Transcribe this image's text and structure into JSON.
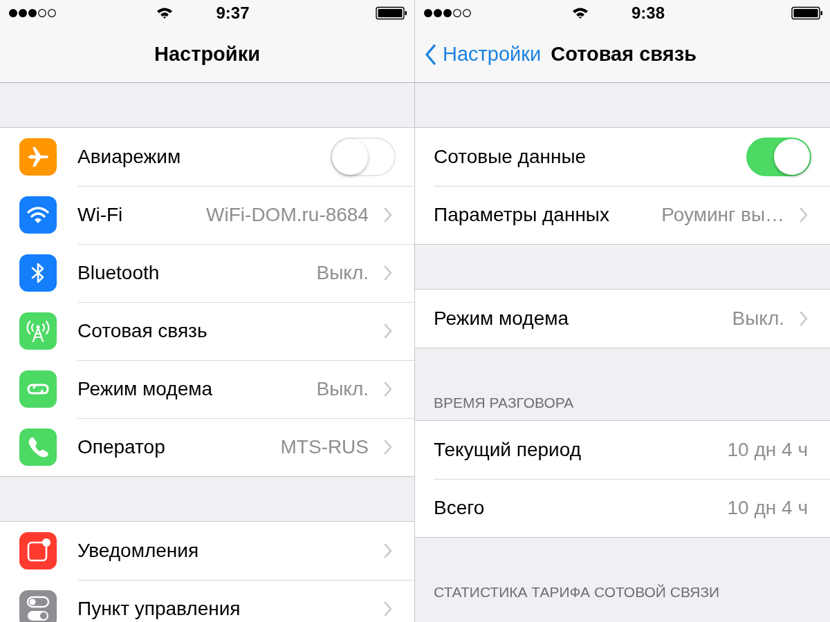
{
  "screens": [
    {
      "status_bar": {
        "time": "9:37"
      },
      "nav": {
        "title": "Настройки"
      },
      "sections": [
        {
          "rows": [
            {
              "kind": "switch",
              "label": "Авиарежим",
              "on": false,
              "color": "#ff9500"
            },
            {
              "kind": "link",
              "label": "Wi-Fi",
              "value": "WiFi-DOM.ru-8684",
              "color": "#147efb"
            },
            {
              "kind": "link",
              "label": "Bluetooth",
              "value": "Выкл.",
              "color": "#147efb"
            },
            {
              "kind": "link",
              "label": "Сотовая связь",
              "color": "#4cd964"
            },
            {
              "kind": "link",
              "label": "Режим модема",
              "value": "Выкл.",
              "color": "#4cd964"
            },
            {
              "kind": "link",
              "label": "Оператор",
              "value": "MTS-RUS",
              "color": "#4cd964"
            }
          ]
        },
        {
          "rows": [
            {
              "kind": "link",
              "label": "Уведомления",
              "color": "#ff3b30"
            },
            {
              "kind": "link",
              "label": "Пункт управления",
              "color": "#8e8e93"
            }
          ]
        }
      ]
    },
    {
      "status_bar": {
        "time": "9:38"
      },
      "nav": {
        "back": "Настройки",
        "title": "Сотовая связь"
      },
      "sections": [
        {
          "rows": [
            {
              "kind": "switch",
              "label": "Сотовые данные",
              "on": true
            },
            {
              "kind": "link",
              "label": "Параметры данных",
              "value": "Роуминг вы…"
            }
          ]
        },
        {
          "rows": [
            {
              "kind": "link",
              "label": "Режим модема",
              "value": "Выкл."
            }
          ]
        },
        {
          "header": "ВРЕМЯ РАЗГОВОРА",
          "rows": [
            {
              "kind": "plain",
              "label": "Текущий период",
              "value": "10 дн 4 ч"
            },
            {
              "kind": "plain",
              "label": "Всего",
              "value": "10 дн 4 ч"
            }
          ]
        },
        {
          "header": "СТАТИСТИКА ТАРИФА СОТОВОЙ СВЯЗИ"
        }
      ]
    }
  ]
}
